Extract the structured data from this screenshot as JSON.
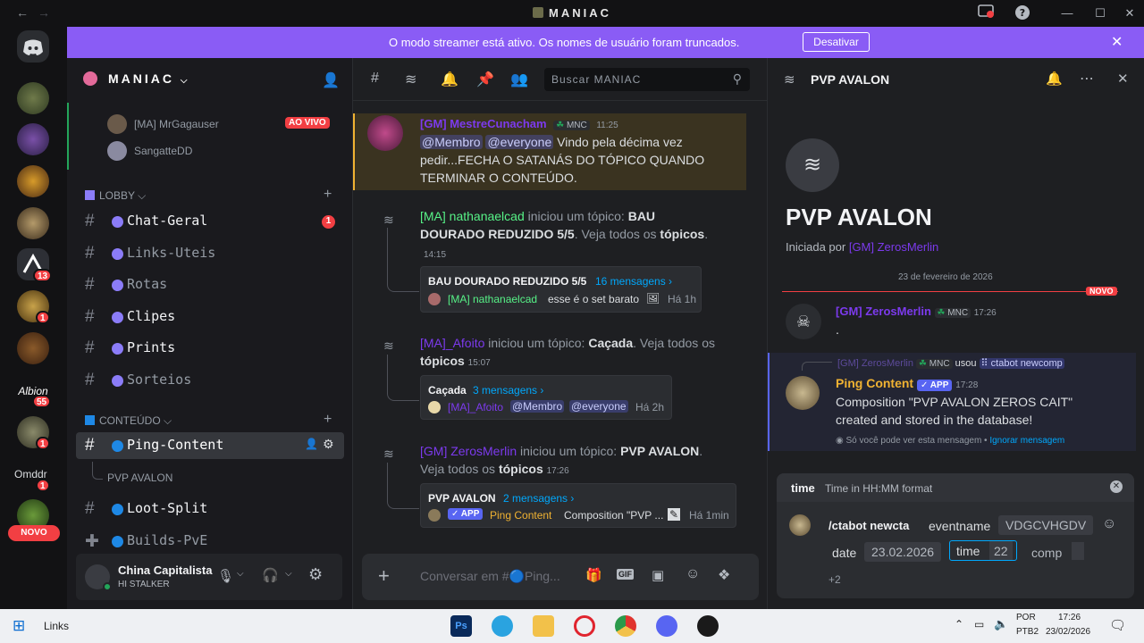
{
  "window": {
    "title": "MANIAC",
    "icons": [
      "back-icon",
      "forward-icon",
      "inbox-icon",
      "help-icon",
      "minimize-icon",
      "maximize-icon",
      "close-icon"
    ]
  },
  "banner": {
    "text": "O modo streamer está ativo. Os nomes de usuário foram truncados.",
    "button": "Desativar",
    "color": "#8a5cf5"
  },
  "servers": {
    "badges": [
      "13",
      "1",
      "1",
      "55",
      "1",
      "1"
    ],
    "new_label": "NOVO",
    "text_server": "Omddr"
  },
  "guild": {
    "name": "MANIAC"
  },
  "voice": {
    "users": [
      "[MA] MrGagauser",
      "SangatteDD"
    ],
    "live": "AO VIVO"
  },
  "categories": {
    "lobby": "LOBBY",
    "conteudo": "CONTEÚDO"
  },
  "channels": {
    "chat_geral": "Chat-Geral",
    "chat_geral_badge": "1",
    "links_uteis": "Links-Uteis",
    "rotas": "Rotas",
    "clipes": "Clipes",
    "prints": "Prints",
    "sorteios": "Sorteios",
    "ping_content": "Ping-Content",
    "pvp_avalon": "PVP AVALON",
    "loot_split": "Loot-Split",
    "builds_pve": "Builds-PvE"
  },
  "user": {
    "name": "China Capitalista",
    "status": "HI STALKER"
  },
  "main": {
    "search_placeholder": "Buscar MANIAC",
    "composer_placeholder": "Conversar em #🔵Ping..."
  },
  "messages": {
    "m1": {
      "author": "[GM] MestreCunacham",
      "tag": "MNC",
      "time": "11:25",
      "mention1": "@Membro",
      "mention2": "@everyone",
      "text": " Vindo pela décima vez pedir...FECHA O SATANÁS DO TÓPICO QUANDO TERMINAR O CONTEÚDO."
    },
    "t1": {
      "author": "[MA] nathanaelcad",
      "action": " iniciou um tópico: ",
      "topic": "BAU DOURADO REDUZIDO 5/5",
      "see": ". Veja todos os ",
      "topics": "tópicos",
      "time": "14:15",
      "card_title": "BAU DOURADO REDUZIDO 5/5",
      "card_count": "16 mensagens ›",
      "card_author": "[MA] nathanaelcad",
      "card_text": "esse é o set barato",
      "card_ago": "Há 1h"
    },
    "t2": {
      "author": "[MA]_Afoito",
      "action": " iniciou um tópico: ",
      "topic": "Caçada",
      "see": ". Veja todos os ",
      "topics": "tópicos",
      "time": "15:07",
      "card_title": "Caçada",
      "card_count": "3 mensagens ›",
      "card_author": "[MA]_Afoito",
      "mention1": "@Membro",
      "mention2": "@everyone",
      "card_ago": "Há 2h"
    },
    "t3": {
      "author": "[GM] ZerosMerlin",
      "action": " iniciou um tópico: ",
      "topic": "PVP AVALON",
      "see": ". Veja todos os ",
      "topics": "tópicos",
      "time": "17:26",
      "card_title": "PVP AVALON",
      "card_count": "2 mensagens ›",
      "app": "APP",
      "card_author": "Ping Content",
      "card_text": "Composition \"PVP ...",
      "card_ago": "Há 1min"
    }
  },
  "thread": {
    "title": "PVP AVALON",
    "started_by": "Iniciada por ",
    "starter": "[GM] ZerosMerlin",
    "date": "23 de fevereiro de 2026",
    "new": "NOVO",
    "msg1": {
      "author": "[GM] ZerosMerlin",
      "tag": "MNC",
      "time": "17:26",
      "text": "."
    },
    "msg2": {
      "ref_author": "[GM] ZerosMerlin",
      "ref_tag": "MNC",
      "used": "usou",
      "command": "ctabot newcomp",
      "author": "Ping Content",
      "app": "APP",
      "time": "17:28",
      "text": "Composition \"PVP AVALON ZEROS CAIT\" created and stored in the database!",
      "ephemeral": "Só você pode ver esta mensagem • ",
      "dismiss": "Ignorar mensagem"
    }
  },
  "autocomplete": {
    "option": "time",
    "description": "Time in HH:MM format",
    "command": "/ctabot newcta",
    "eventname_label": "eventname",
    "eventname_value": "VDGCVHGDV",
    "date_label": "date",
    "date_value": "23.02.2026",
    "time_label": "time",
    "time_value": "22",
    "comp_label": "comp",
    "more": "+2"
  },
  "taskbar": {
    "links": "Links",
    "lang1": "POR",
    "lang2": "PTB2",
    "time": "17:26",
    "date": "23/02/2026"
  }
}
